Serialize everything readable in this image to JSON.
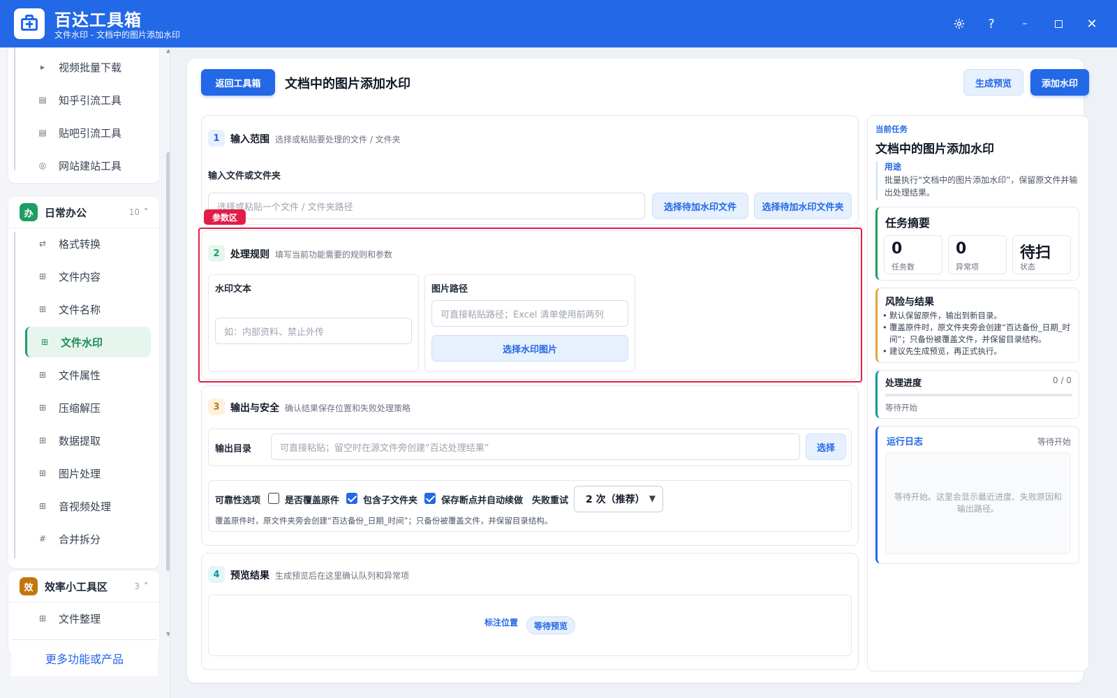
{
  "app": {
    "title": "百达工具箱",
    "subtitle": "文件水印 - 文档中的图片添加水印",
    "window_controls": [
      "settings-icon",
      "help-icon",
      "minimize-icon",
      "maximize-icon",
      "close-icon"
    ],
    "brand_color": "#2368e6"
  },
  "sidebar": {
    "top_items": [
      {
        "label": "视频批量下载",
        "icon": "play-icon"
      },
      {
        "label": "知乎引流工具",
        "icon": "doc-icon"
      },
      {
        "label": "贴吧引流工具",
        "icon": "doc-icon"
      },
      {
        "label": "网站建站工具",
        "icon": "globe-icon"
      }
    ],
    "groups": [
      {
        "badge": "办",
        "badge_color": "#1f9d63",
        "name": "日常办公",
        "count": "10",
        "caret": "˄",
        "items": [
          {
            "label": "格式转换",
            "icon": "swap-icon"
          },
          {
            "label": "文件内容",
            "icon": "grid-icon"
          },
          {
            "label": "文件名称",
            "icon": "grid-icon"
          },
          {
            "label": "文件水印",
            "icon": "grid-icon",
            "active": true
          },
          {
            "label": "文件属性",
            "icon": "grid-icon"
          },
          {
            "label": "压缩解压",
            "icon": "grid-icon"
          },
          {
            "label": "数据提取",
            "icon": "grid-icon"
          },
          {
            "label": "图片处理",
            "icon": "grid-icon"
          },
          {
            "label": "音视频处理",
            "icon": "grid-icon"
          },
          {
            "label": "合并拆分",
            "icon": "hash-icon"
          }
        ]
      },
      {
        "badge": "效",
        "badge_color": "#c2770e",
        "name": "效率小工具区",
        "count": "3",
        "caret": "˄",
        "items": [
          {
            "label": "文件整理",
            "icon": "grid-icon"
          }
        ]
      }
    ],
    "more_label": "更多功能或产品"
  },
  "main": {
    "back_button": "返回工具箱",
    "page_title": "文档中的图片添加水印",
    "preview_button": "生成预览",
    "run_button": "添加水印",
    "highlight_tag": "参数区",
    "sections": {
      "input": {
        "num": "1",
        "title": "输入范围",
        "desc": "选择或粘贴要处理的文件 / 文件夹",
        "field_label": "输入文件或文件夹",
        "placeholder": "选择或粘贴一个文件 / 文件夹路径",
        "btn_file": "选择待加水印文件",
        "btn_folder": "选择待加水印文件夹"
      },
      "rules": {
        "num": "2",
        "title": "处理规则",
        "desc": "填写当前功能需要的规则和参数",
        "watermark_text_label": "水印文本",
        "watermark_text_placeholder": "如：内部资料、禁止外传",
        "image_path_label": "图片路径",
        "image_path_placeholder": "可直接粘贴路径；Excel 清单使用前两列",
        "image_btn": "选择水印图片"
      },
      "output": {
        "num": "3",
        "title": "输出与安全",
        "desc": "确认结果保存位置和失败处理策略",
        "dir_label": "输出目录",
        "dir_placeholder": "可直接粘贴；留空时在源文件旁创建“百达处理结果”",
        "dir_btn": "选择",
        "reliability_label": "可靠性选项",
        "overwrite_label": "是否覆盖原件",
        "overwrite_checked": false,
        "subfolder_label": "包含子文件夹",
        "subfolder_checked": true,
        "resume_label": "保存断点并自动续做",
        "resume_checked": true,
        "retry_label": "失败重试",
        "retry_value": "2 次（推荐）",
        "note": "覆盖原件时，原文件夹旁会创建“百达备份_日期_时间”；只备份被覆盖文件，并保留目录结构。"
      },
      "preview": {
        "num": "4",
        "title": "预览结果",
        "desc": "生成预览后在这里确认队列和异常项",
        "pos_label": "标注位置",
        "status_pill": "等待预览"
      }
    }
  },
  "right_panel": {
    "current_label": "当前任务",
    "current_title": "文档中的图片添加水印",
    "purpose_label": "用途",
    "purpose_text": "批量执行“文档中的图片添加水印”，保留原文件并输出处理结果。",
    "summary_title": "任务摘要",
    "stats": [
      {
        "value": "0",
        "label": "任务数"
      },
      {
        "value": "0",
        "label": "异常项"
      },
      {
        "value": "待扫",
        "label": "状态"
      }
    ],
    "risk_title": "风险与结果",
    "risk_items": [
      "默认保留原件，输出到新目录。",
      "覆盖原件时，原文件夹旁会创建“百达备份_日期_时间”；只备份被覆盖文件，并保留目录结构。",
      "建议先生成预览，再正式执行。"
    ],
    "progress_title": "处理进度",
    "progress_count": "0 / 0",
    "progress_fraction": 0,
    "progress_status": "等待开始",
    "log_title": "运行日志",
    "log_status": "等待开始",
    "log_placeholder": "等待开始。这里会显示最近进度、失败原因和输出路径。"
  }
}
